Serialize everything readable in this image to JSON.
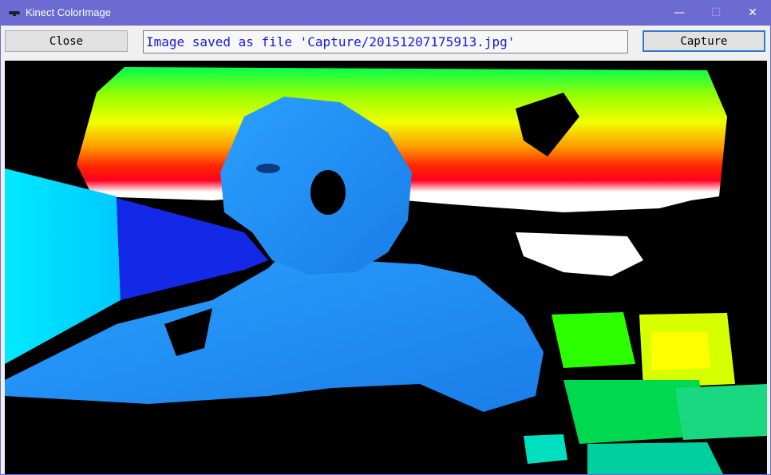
{
  "window": {
    "title": "Kinect ColorImage",
    "controls": {
      "minimize": "—",
      "maximize": "☐",
      "close": "✕"
    },
    "icon": "kinect-sensor-icon"
  },
  "toolbar": {
    "close_label": "Close",
    "status_text": "Image saved as file 'Capture/20151207175913.jpg'",
    "capture_label": "Capture"
  },
  "colors": {
    "titlebar": "#6b6bd1",
    "status_text": "#1a1adb",
    "capture_focus": "#2f79d0"
  }
}
